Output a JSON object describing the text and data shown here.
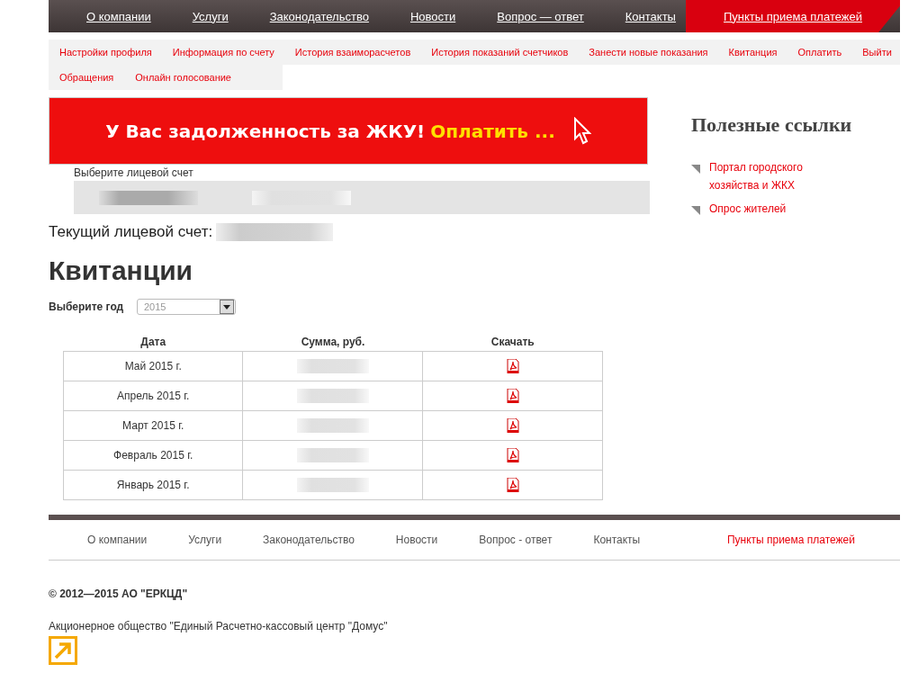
{
  "top_nav": {
    "items": [
      {
        "label": "О компании",
        "kind": "normal"
      },
      {
        "label": "Услуги",
        "kind": "normal"
      },
      {
        "label": "Законодательство",
        "kind": "normal"
      },
      {
        "label": "Новости",
        "kind": "normal"
      },
      {
        "label": "Вопрос — ответ",
        "kind": "normal"
      },
      {
        "label": "Контакты",
        "kind": "normal"
      },
      {
        "label": "Пункты приема платежей",
        "kind": "highlight"
      }
    ]
  },
  "account_menu": {
    "rows": [
      [
        "Настройки профиля",
        "Информация по счету",
        "История взаиморасчетов",
        "История показаний счетчиков",
        "Занести новые показания",
        "Квитанция",
        "Оплатить",
        "Выйти"
      ],
      [
        "Обращения",
        "Онлайн голосование"
      ]
    ]
  },
  "debt_banner": {
    "message": "У Вас задолженность за ЖКУ!",
    "link": "Оплатить ..."
  },
  "account_select": {
    "label": "Выберите лицевой счет"
  },
  "current_account": {
    "label": "Текущий лицевой счет:"
  },
  "page_title": "Квитанции",
  "year_select": {
    "label": "Выберите год",
    "value": "2015"
  },
  "receipts_table": {
    "columns": [
      "Дата",
      "Сумма, руб.",
      "Скачать"
    ],
    "rows": [
      {
        "date": "Май 2015 г."
      },
      {
        "date": "Апрель 2015 г."
      },
      {
        "date": "Март 2015 г."
      },
      {
        "date": "Февраль 2015 г."
      },
      {
        "date": "Январь 2015 г."
      }
    ]
  },
  "sidebar": {
    "title": "Полезные ссылки",
    "links": [
      "Портал городского хозяйства и ЖКХ",
      "Опрос жителей"
    ]
  },
  "footer": {
    "nav": [
      {
        "label": "О компании",
        "kind": "normal"
      },
      {
        "label": "Услуги",
        "kind": "normal"
      },
      {
        "label": "Законодательство",
        "kind": "normal"
      },
      {
        "label": "Новости",
        "kind": "normal"
      },
      {
        "label": "Вопрос - ответ",
        "kind": "normal"
      },
      {
        "label": "Контакты",
        "kind": "normal"
      },
      {
        "label": "Пункты приема платежей",
        "kind": "highlight"
      }
    ],
    "copyright": "© 2012—2015 АО \"ЕРКЦД\"",
    "company": "Акционерное общество \"Единый Расчетно-кассовый центр \"Домус\""
  }
}
